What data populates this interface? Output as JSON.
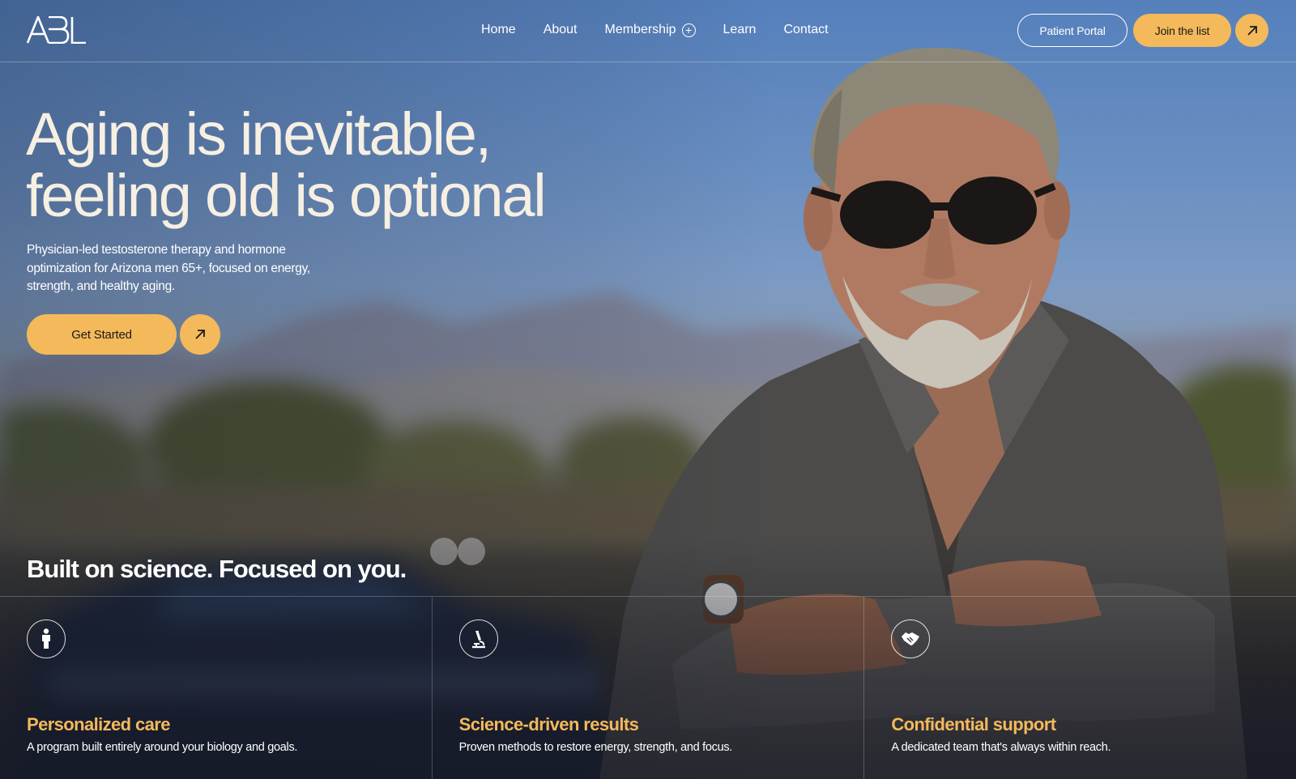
{
  "brand": {
    "logo_text": "ABL"
  },
  "nav": {
    "items": [
      {
        "label": "Home"
      },
      {
        "label": "About"
      },
      {
        "label": "Membership",
        "icon": "plus-circle-icon"
      },
      {
        "label": "Learn"
      },
      {
        "label": "Contact"
      }
    ]
  },
  "header_actions": {
    "portal_label": "Patient Portal",
    "join_label": "Join the list",
    "join_arrow_icon": "arrow-up-right-icon"
  },
  "hero": {
    "title_line1": "Aging is inevitable,",
    "title_line2": "feeling old is optional",
    "subtitle": "Physician-led testosterone therapy and hormone optimization for Arizona men 65+, focused on energy, strength, and healthy aging.",
    "cta_label": "Get Started",
    "cta_arrow_icon": "arrow-up-right-icon"
  },
  "features": {
    "heading": "Built on science.  Focused on you.",
    "items": [
      {
        "icon": "person-icon",
        "title": "Personalized care",
        "description": "A program built entirely around your biology and goals."
      },
      {
        "icon": "microscope-icon",
        "title": "Science-driven results",
        "description": "Proven methods to restore energy, strength, and focus."
      },
      {
        "icon": "handshake-icon",
        "title": "Confidential support",
        "description": "A dedicated team that's always within reach."
      }
    ]
  },
  "colors": {
    "accent": "#f4b95b",
    "title_cream": "#f6efe2",
    "sky": "#5580bc"
  }
}
